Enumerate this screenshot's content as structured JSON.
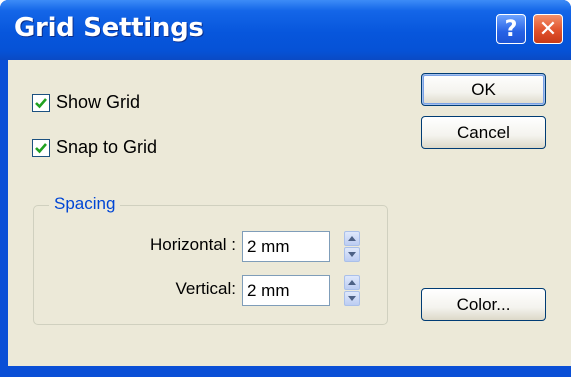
{
  "window": {
    "title": "Grid Settings",
    "help_glyph": "?",
    "close_glyph": "✕"
  },
  "options": {
    "show_grid": {
      "label": "Show Grid",
      "checked": true
    },
    "snap_to_grid": {
      "label": "Snap to Grid",
      "checked": true
    }
  },
  "buttons": {
    "ok": "OK",
    "cancel": "Cancel",
    "color": "Color..."
  },
  "spacing": {
    "legend": "Spacing",
    "horizontal_label": "Horizontal :",
    "horizontal_value": "2 mm",
    "vertical_label": "Vertical:",
    "vertical_value": "2 mm"
  },
  "colors": {
    "title_bar": "#0652d6",
    "dialog_bg": "#ece9d8",
    "group_text": "#0046d5",
    "checkmark": "#21a121"
  },
  "icons": [
    "help-icon",
    "close-icon",
    "checkmark-icon",
    "spin-up-icon",
    "spin-down-icon"
  ]
}
